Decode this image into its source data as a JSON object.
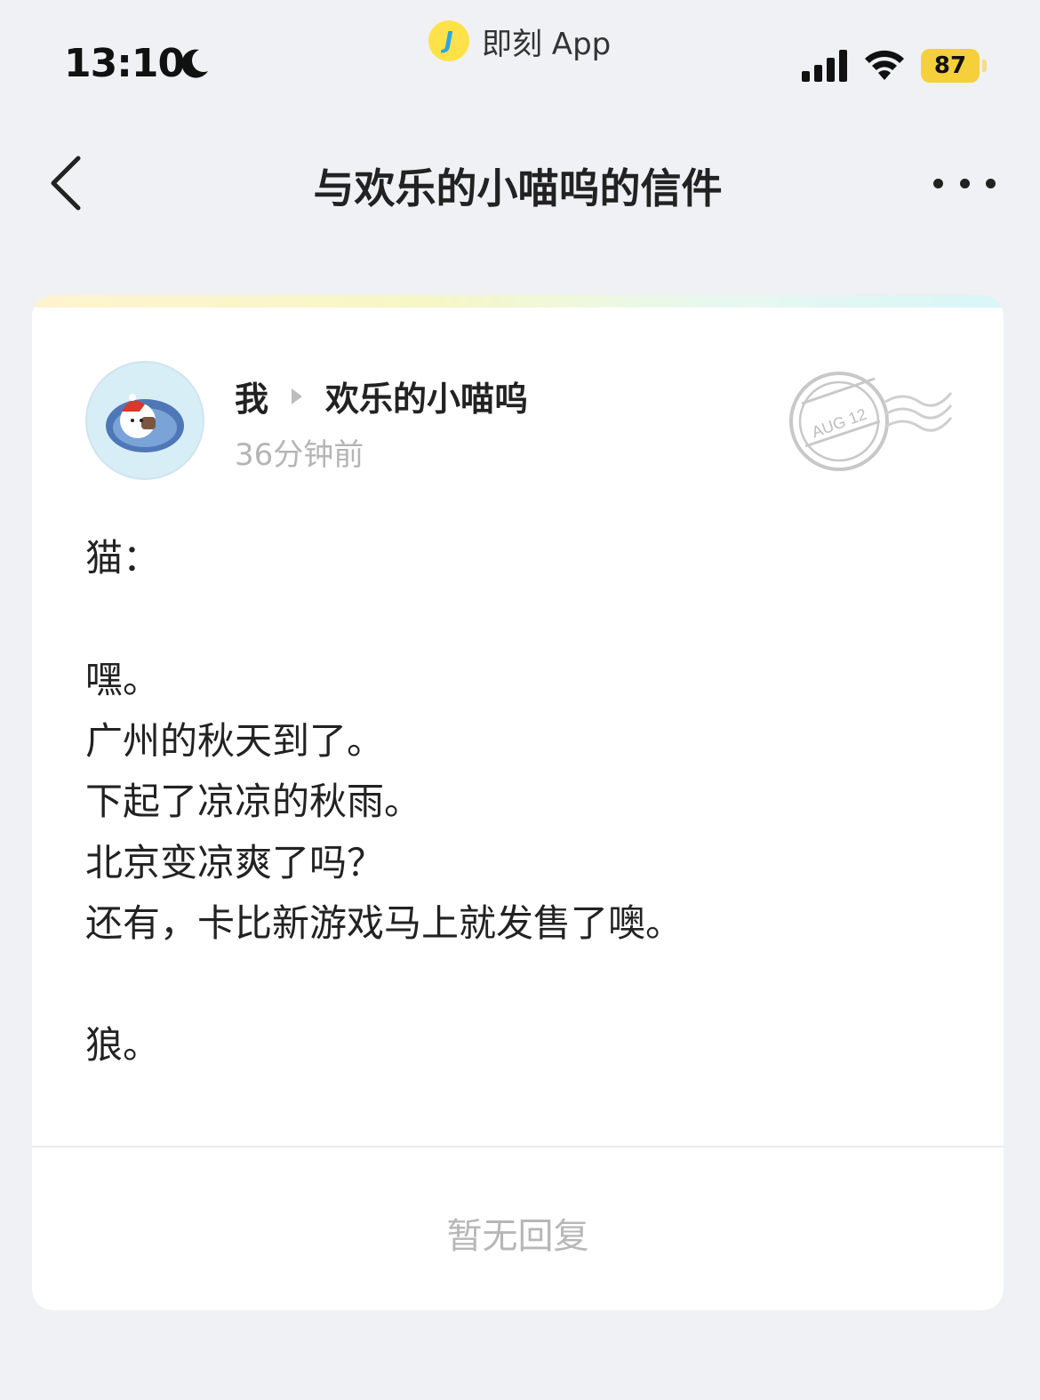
{
  "status_bar": {
    "time": "13:10",
    "source_app": "即刻 App",
    "battery": "87",
    "icons": [
      "moon-icon",
      "signal-icon",
      "wifi-icon",
      "battery-icon"
    ]
  },
  "nav": {
    "title": "与欢乐的小喵呜的信件",
    "icons": [
      "back-arrow-icon",
      "more-icon"
    ]
  },
  "letter": {
    "from": "我",
    "to": "欢乐的小喵呜",
    "time_ago": "36分钟前",
    "postmark_text": "AUG 12",
    "body": "猫：\n\n嘿。\n广州的秋天到了。\n下起了凉凉的秋雨。\n北京变凉爽了吗？\n还有，卡比新游戏马上就发售了噢。\n\n狼。"
  },
  "reply_status": "暂无回复",
  "colors": {
    "background": "#f0f1f4",
    "card": "#ffffff",
    "accent_yellow": "#f6d03a",
    "muted_text": "#b5b5b5"
  }
}
